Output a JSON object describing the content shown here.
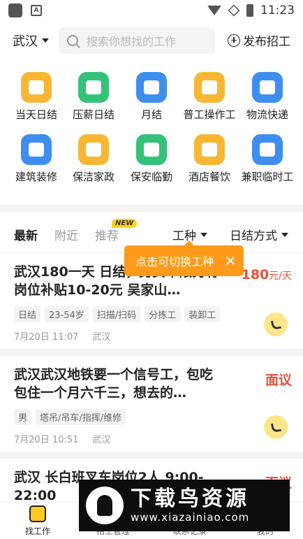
{
  "status_bar": {
    "time": "11:23",
    "icons": [
      "app-icon",
      "a-notification-icon",
      "wifi-icon",
      "no-signal-icon",
      "battery-charging-icon"
    ]
  },
  "header": {
    "city": "武汉",
    "search_placeholder": "搜索你想找的工作",
    "publish_label": "发布招工"
  },
  "categories": [
    {
      "label": "当天日结",
      "color": "#f7b733",
      "icon": "user-clock-icon"
    },
    {
      "label": "压薪日结",
      "color": "#34c27a",
      "icon": "wage-document-icon"
    },
    {
      "label": "月结",
      "color": "#3d8ef0",
      "icon": "calendar-30-icon"
    },
    {
      "label": "普工操作工",
      "color": "#f7b733",
      "icon": "building-icon"
    },
    {
      "label": "物流快递",
      "color": "#3d8ef0",
      "icon": "truck-icon"
    },
    {
      "label": "建筑装修",
      "color": "#3d8ef0",
      "icon": "paint-roller-icon"
    },
    {
      "label": "保洁家政",
      "color": "#f7b733",
      "icon": "broom-icon"
    },
    {
      "label": "保安临勤",
      "color": "#34c27a",
      "icon": "security-guard-icon"
    },
    {
      "label": "酒店餐饮",
      "color": "#f7b733",
      "icon": "food-cloche-icon"
    },
    {
      "label": "兼职临时工",
      "color": "#3d8ef0",
      "icon": "briefcase-icon"
    }
  ],
  "tabs": {
    "latest": "最新",
    "nearby": "附近",
    "recommend": "推荐",
    "new_badge": "NEW",
    "work_type": "工种",
    "settlement": "日结方式"
  },
  "tooltip": {
    "text": "点击可切换工种"
  },
  "jobs": [
    {
      "title": "武汉180一天  日结，男女不限另有岗位补贴10-20元  吴家山…",
      "salary_amount": "180",
      "salary_unit": "元/天",
      "tags": [
        "日结",
        "23-54岁",
        "扫描/扫码",
        "分拣工",
        "装卸工"
      ],
      "date": "7月20日 11:07",
      "location": "武汉"
    },
    {
      "title": "武汉武汉地铁要一个信号工，包吃包住一个月六千三，想去的…",
      "salary_amount": "面议",
      "salary_unit": "",
      "tags": [
        "男",
        "塔吊/吊车/指挥/维修"
      ],
      "date": "7月20日 10:51",
      "location": "武汉"
    },
    {
      "title": "武汉 长白班叉车岗位2人 9:00-22:00",
      "salary_amount": "面议",
      "salary_unit": "",
      "tags": [],
      "date": "",
      "location": ""
    }
  ],
  "bottom_nav": [
    {
      "label": "找工作",
      "active": true
    },
    {
      "label": "招工管理",
      "active": false
    },
    {
      "label": "联系记录",
      "active": false
    },
    {
      "label": "我的",
      "active": false
    }
  ],
  "watermark": {
    "title": "下载鸟资源",
    "url": "www.xiazainiao.com"
  }
}
